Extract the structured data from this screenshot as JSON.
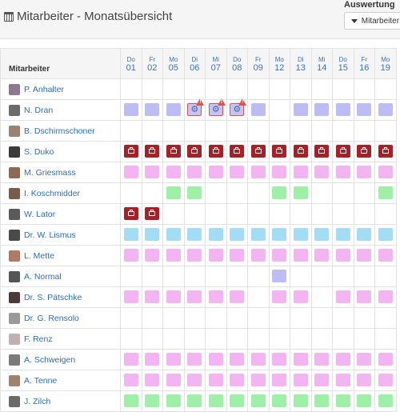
{
  "header": {
    "title": "Mitarbeiter - Monatsübersicht",
    "auswertung_label": "Auswertung",
    "filter_button_label": "Mitarbeiter filtern"
  },
  "table": {
    "name_header": "Mitarbeiter",
    "days": [
      {
        "dow": "Do",
        "num": "01"
      },
      {
        "dow": "Fr",
        "num": "02"
      },
      {
        "dow": "Mo",
        "num": "05"
      },
      {
        "dow": "Di",
        "num": "06"
      },
      {
        "dow": "Mi",
        "num": "07"
      },
      {
        "dow": "Do",
        "num": "08"
      },
      {
        "dow": "Fr",
        "num": "09"
      },
      {
        "dow": "Mo",
        "num": "12"
      },
      {
        "dow": "Di",
        "num": "13"
      },
      {
        "dow": "Mi",
        "num": "14"
      },
      {
        "dow": "Do",
        "num": "15"
      },
      {
        "dow": "Fr",
        "num": "16"
      },
      {
        "dow": "Mo",
        "num": "19"
      }
    ],
    "rows": [
      {
        "name": "P. Anhalter",
        "avatar_color": "#8a7a8f",
        "cells": [
          "",
          "",
          "",
          "",
          "",
          "",
          "",
          "",
          "",
          "",
          "",
          "",
          ""
        ]
      },
      {
        "name": "N. Dran",
        "avatar_color": "#6b6b6b",
        "cells": [
          "purple",
          "purple",
          "purple",
          "gear-warn",
          "gear-warn",
          "gear-warn",
          "purple",
          "",
          "purple",
          "purple",
          "purple",
          "purple",
          "purple"
        ]
      },
      {
        "name": "B. Dschirmschoner",
        "avatar_color": "#9a8170",
        "cells": [
          "",
          "",
          "",
          "",
          "",
          "",
          "",
          "",
          "",
          "",
          "",
          "",
          ""
        ]
      },
      {
        "name": "S. Duko",
        "avatar_color": "#3a3a3a",
        "cells": [
          "red",
          "red",
          "red",
          "red",
          "red",
          "red",
          "red",
          "red",
          "red",
          "red",
          "red",
          "red",
          "red"
        ]
      },
      {
        "name": "M. Griesmass",
        "avatar_color": "#8c6a55",
        "cells": [
          "pink",
          "pink",
          "pink",
          "pink",
          "pink",
          "pink",
          "pink",
          "pink",
          "pink",
          "pink",
          "pink",
          "pink",
          "pink"
        ]
      },
      {
        "name": "I. Koschmidder",
        "avatar_color": "#7a5a4a",
        "cells": [
          "",
          "",
          "green",
          "green",
          "",
          "",
          "",
          "green",
          "green",
          "",
          "",
          "",
          "green"
        ]
      },
      {
        "name": "W. Lator",
        "avatar_color": "#5a5a5a",
        "cells": [
          "red",
          "red",
          "",
          "",
          "",
          "",
          "",
          "",
          "",
          "",
          "",
          "",
          ""
        ]
      },
      {
        "name": "Dr. W. Lismus",
        "avatar_color": "#4a4a4a",
        "cells": [
          "blue",
          "blue",
          "blue",
          "blue",
          "blue",
          "blue",
          "blue",
          "blue",
          "blue",
          "blue",
          "blue",
          "blue",
          "blue"
        ]
      },
      {
        "name": "L. Mette",
        "avatar_color": "#b07a60",
        "cells": [
          "pink",
          "pink",
          "pink",
          "pink",
          "pink",
          "pink",
          "pink",
          "pink",
          "pink",
          "pink",
          "pink",
          "pink",
          "pink"
        ]
      },
      {
        "name": "A. Normal",
        "avatar_color": "#555555",
        "cells": [
          "",
          "",
          "",
          "",
          "",
          "",
          "",
          "purple",
          "",
          "",
          "",
          "",
          ""
        ]
      },
      {
        "name": "Dr. S. Pätschke",
        "avatar_color": "#4a3a3a",
        "cells": [
          "pink",
          "pink",
          "pink",
          "pink",
          "pink",
          "pink",
          "",
          "pink",
          "pink",
          "",
          "pink",
          "pink",
          "pink"
        ]
      },
      {
        "name": "Dr. G. Rensolo",
        "avatar_color": "#9a9a9a",
        "cells": [
          "",
          "",
          "",
          "",
          "",
          "",
          "",
          "",
          "",
          "",
          "",
          "",
          ""
        ]
      },
      {
        "name": "F. Renz",
        "avatar_color": "#c0b0b0",
        "cells": [
          "",
          "",
          "",
          "",
          "",
          "",
          "",
          "",
          "",
          "",
          "",
          "",
          ""
        ]
      },
      {
        "name": "A. Schweigen",
        "avatar_color": "#7a7a7a",
        "cells": [
          "pink",
          "pink",
          "pink",
          "pink",
          "pink",
          "pink",
          "pink",
          "pink",
          "pink",
          "pink",
          "pink",
          "pink",
          "pink"
        ]
      },
      {
        "name": "A. Tenne",
        "avatar_color": "#a08070",
        "cells": [
          "pink",
          "pink",
          "pink",
          "pink",
          "pink",
          "pink",
          "pink",
          "pink",
          "pink",
          "pink",
          "pink",
          "pink",
          "pink"
        ]
      },
      {
        "name": "J. Zilch",
        "avatar_color": "#6a6a6a",
        "cells": [
          "green",
          "green",
          "green",
          "green",
          "green",
          "green",
          "green",
          "green",
          "green",
          "green",
          "green",
          "green",
          "green"
        ]
      }
    ]
  }
}
